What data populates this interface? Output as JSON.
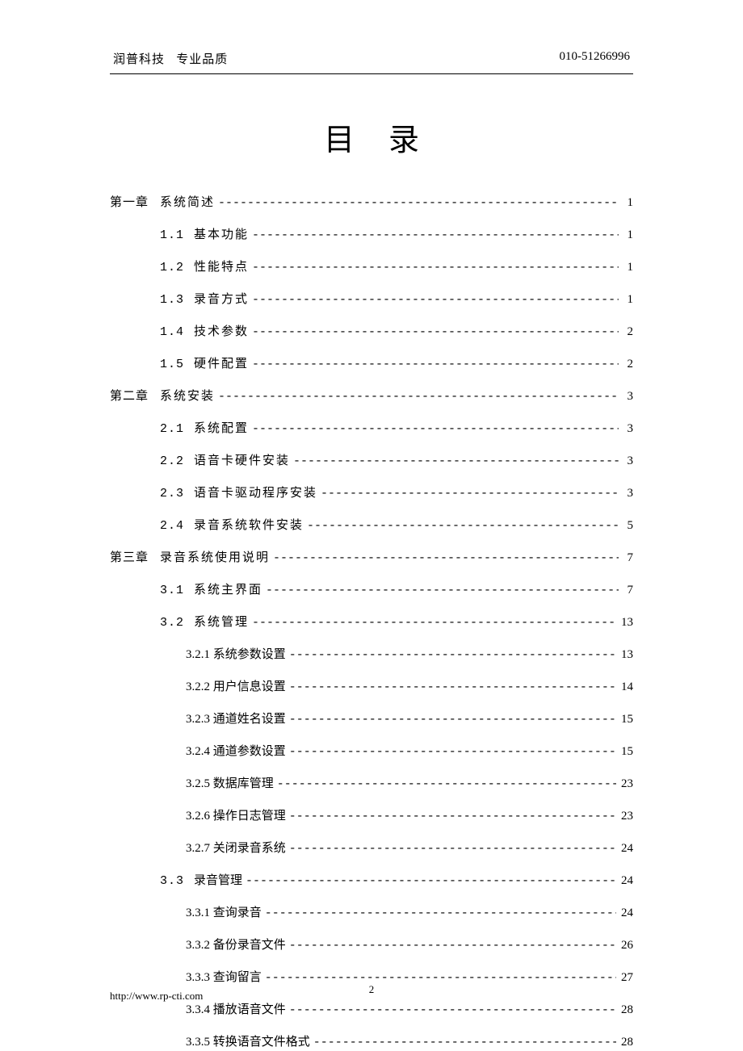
{
  "header": {
    "company": "润普科技",
    "slogan": "专业品质",
    "phone": "010-51266996"
  },
  "title": "目录",
  "toc": [
    {
      "level": 1,
      "chapter": "第一章",
      "num": "",
      "label": "系统简述",
      "page": "1"
    },
    {
      "level": 2,
      "chapter": "",
      "num": "1.1",
      "label": "基本功能",
      "page": "1"
    },
    {
      "level": 2,
      "chapter": "",
      "num": "1.2",
      "label": "性能特点",
      "page": "1"
    },
    {
      "level": 2,
      "chapter": "",
      "num": "1.3",
      "label": "录音方式",
      "page": "1"
    },
    {
      "level": 2,
      "chapter": "",
      "num": "1.4",
      "label": "技术参数",
      "page": "2"
    },
    {
      "level": 2,
      "chapter": "",
      "num": "1.5",
      "label": "硬件配置",
      "page": "2"
    },
    {
      "level": 1,
      "chapter": "第二章",
      "num": "",
      "label": "系统安装",
      "page": "3"
    },
    {
      "level": 2,
      "chapter": "",
      "num": "2.1",
      "label": "系统配置",
      "page": "3"
    },
    {
      "level": 2,
      "chapter": "",
      "num": "2.2",
      "label": "语音卡硬件安装",
      "page": "3"
    },
    {
      "level": 2,
      "chapter": "",
      "num": "2.3",
      "label": "语音卡驱动程序安装",
      "page": "3"
    },
    {
      "level": 2,
      "chapter": "",
      "num": "2.4",
      "label": "录音系统软件安装",
      "page": "5"
    },
    {
      "level": 1,
      "chapter": "第三章",
      "num": "",
      "label": "录音系统使用说明",
      "page": "7"
    },
    {
      "level": 2,
      "chapter": "",
      "num": "3.1",
      "label": "系统主界面",
      "page": "7"
    },
    {
      "level": 2,
      "chapter": "",
      "num": "3.2",
      "label": "系统管理",
      "page": "13"
    },
    {
      "level": 3,
      "chapter": "",
      "num": "3.2.1",
      "label": "系统参数设置",
      "page": "13"
    },
    {
      "level": 3,
      "chapter": "",
      "num": "3.2.2",
      "label": "用户信息设置",
      "page": "14"
    },
    {
      "level": 3,
      "chapter": "",
      "num": "3.2.3",
      "label": "通道姓名设置",
      "page": "15"
    },
    {
      "level": 3,
      "chapter": "",
      "num": "3.2.4",
      "label": "通道参数设置",
      "page": "15"
    },
    {
      "level": 3,
      "chapter": "",
      "num": "3.2.5",
      "label": "数据库管理",
      "page": "23"
    },
    {
      "level": 3,
      "chapter": "",
      "num": "3.2.6",
      "label": "操作日志管理",
      "page": "23"
    },
    {
      "level": 3,
      "chapter": "",
      "num": "3.2.7",
      "label": "关闭录音系统",
      "page": "24"
    },
    {
      "level": 2,
      "chapter": "",
      "num": "3.3",
      "label": "录音管理",
      "page": "24",
      "tight": true
    },
    {
      "level": 3,
      "chapter": "",
      "num": "3.3.1",
      "label": "查询录音",
      "page": "24"
    },
    {
      "level": 3,
      "chapter": "",
      "num": "3.3.2",
      "label": "备份录音文件",
      "page": "26"
    },
    {
      "level": 3,
      "chapter": "",
      "num": "3.3.3",
      "label": "查询留言",
      "page": "27"
    },
    {
      "level": 3,
      "chapter": "",
      "num": "3.3.4",
      "label": "播放语音文件",
      "page": "28"
    },
    {
      "level": 3,
      "chapter": "",
      "num": "3.3.5",
      "label": "转换语音文件格式",
      "page": "28"
    }
  ],
  "footer": {
    "url": "http://www.rp-cti.com",
    "page_number": "2"
  }
}
